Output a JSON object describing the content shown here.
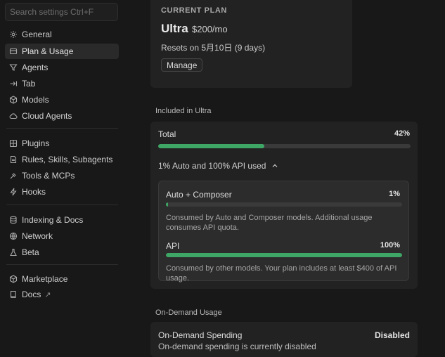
{
  "search": {
    "placeholder": "Search settings Ctrl+F"
  },
  "sidebar": {
    "items": [
      {
        "label": "General",
        "icon": "gear-icon"
      },
      {
        "label": "Plan & Usage",
        "icon": "layers-icon",
        "active": true
      },
      {
        "label": "Agents",
        "icon": "agent-icon"
      },
      {
        "label": "Tab",
        "icon": "tab-arrow-icon"
      },
      {
        "label": "Models",
        "icon": "cube-icon"
      },
      {
        "label": "Cloud Agents",
        "icon": "cloud-icon"
      },
      {
        "label": "Plugins",
        "icon": "puzzle-icon"
      },
      {
        "label": "Rules, Skills, Subagents",
        "icon": "document-icon"
      },
      {
        "label": "Tools & MCPs",
        "icon": "tools-icon"
      },
      {
        "label": "Hooks",
        "icon": "bolt-icon"
      },
      {
        "label": "Indexing & Docs",
        "icon": "database-icon"
      },
      {
        "label": "Network",
        "icon": "globe-icon"
      },
      {
        "label": "Beta",
        "icon": "flask-icon"
      },
      {
        "label": "Marketplace",
        "icon": "package-icon"
      },
      {
        "label": "Docs",
        "icon": "book-icon",
        "external": "↗"
      }
    ]
  },
  "plan": {
    "label": "CURRENT PLAN",
    "name": "Ultra",
    "price": "$200/mo",
    "resets": "Resets on 5月10日 (9 days)",
    "manage_label": "Manage"
  },
  "included": {
    "title": "Included in Ultra",
    "total_label": "Total",
    "total_value": "42%",
    "total_fraction": 0.42,
    "breakdown_toggle": "1% Auto and 100% API used",
    "auto": {
      "label": "Auto + Composer",
      "value": "1%",
      "fraction": 0.01,
      "desc": "Consumed by Auto and Composer models. Additional usage consumes API quota."
    },
    "api": {
      "label": "API",
      "value": "100%",
      "fraction": 1.0,
      "desc": "Consumed by other models. Your plan includes at least $400 of API usage."
    }
  },
  "ondemand": {
    "title": "On-Demand Usage",
    "label": "On-Demand Spending",
    "status": "Disabled",
    "desc": "On-demand spending is currently disabled"
  },
  "colors": {
    "background": "#181818",
    "card": "#222222",
    "accent_green": "#3fa766"
  }
}
